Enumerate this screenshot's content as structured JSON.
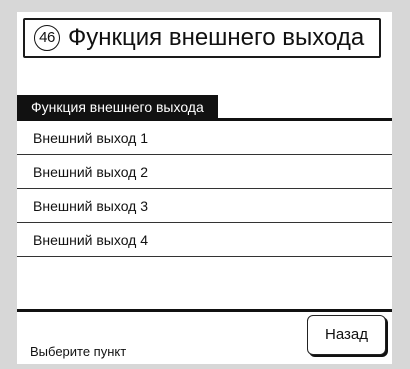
{
  "screen": {
    "number": "46",
    "title": "Функция внешнего выхода"
  },
  "section": {
    "header": "Функция внешнего выхода"
  },
  "list": {
    "items": [
      {
        "label": "Внешний выход 1"
      },
      {
        "label": "Внешний выход 2"
      },
      {
        "label": "Внешний выход 3"
      },
      {
        "label": "Внешний выход 4"
      }
    ]
  },
  "footer": {
    "status": "Выберите пункт",
    "back_label": "Назад"
  }
}
